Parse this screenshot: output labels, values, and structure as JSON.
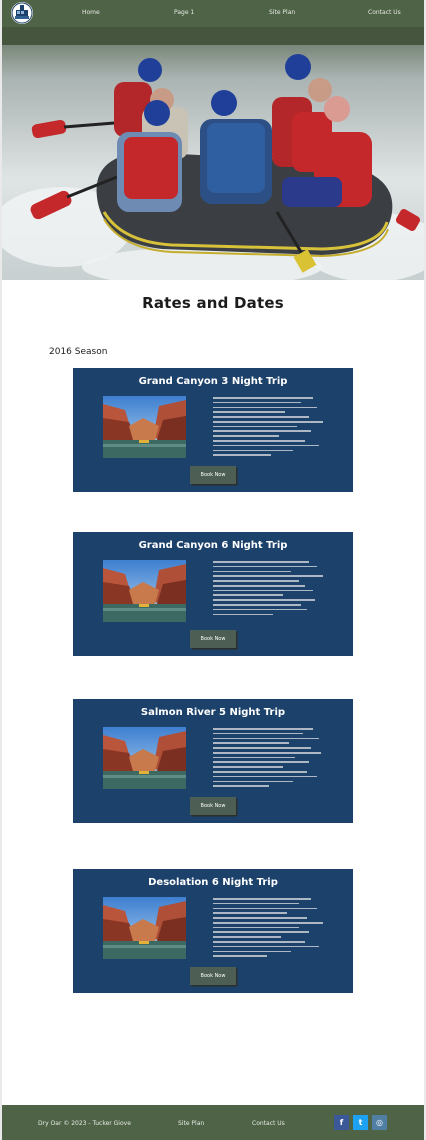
{
  "nav": {
    "items": [
      {
        "label": "Home"
      },
      {
        "label": "Page 1"
      },
      {
        "label": "Site Plan"
      },
      {
        "label": "Contact Us"
      }
    ]
  },
  "main": {
    "title": "Rates and Dates",
    "season": "2016 Season",
    "trips": [
      {
        "title": "Grand Canyon 3 Night Trip",
        "button": "Book Now"
      },
      {
        "title": "Grand Canyon 6 Night Trip",
        "button": "Book Now"
      },
      {
        "title": "Salmon River 5 Night Trip",
        "button": "Book Now"
      },
      {
        "title": "Desolation 6 Night Trip",
        "button": "Book Now"
      }
    ]
  },
  "footer": {
    "copyright": "Dry Oar © 2023 - Tucker Giove",
    "site_plan": "Site Plan",
    "contact": "Contact Us",
    "social": [
      {
        "icon": "facebook-icon",
        "glyph": "f",
        "color": "#3b5998"
      },
      {
        "icon": "twitter-icon",
        "glyph": "t",
        "color": "#1da1f2"
      },
      {
        "icon": "instagram-icon",
        "glyph": "◎",
        "color": "#517fa4"
      }
    ]
  },
  "colors": {
    "nav_bg": "#4f6347",
    "card_bg": "#1c426b",
    "button_bg": "#4d5f55"
  }
}
